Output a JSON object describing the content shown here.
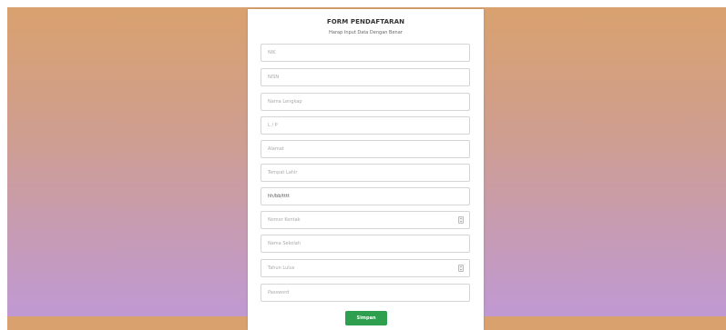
{
  "form": {
    "title": "FORM PENDAFTARAN",
    "subtitle": "Harap Input Data Dengan Benar",
    "fields": [
      {
        "placeholder": "NIK",
        "type": "text"
      },
      {
        "placeholder": "NISN",
        "type": "text"
      },
      {
        "placeholder": "Nama Lengkap",
        "type": "text"
      },
      {
        "placeholder": "L / P",
        "type": "text"
      },
      {
        "placeholder": "Alamat",
        "type": "text"
      },
      {
        "placeholder": "Tempat Lahir",
        "type": "text"
      },
      {
        "value": "hh/bb/tttt",
        "type": "date"
      },
      {
        "placeholder": "Nomor Kontak",
        "type": "number"
      },
      {
        "placeholder": "Nama Sekolah",
        "type": "text"
      },
      {
        "placeholder": "Tahun Lulus",
        "type": "number"
      },
      {
        "placeholder": "Password",
        "type": "password"
      }
    ],
    "submit_label": "Simpan"
  },
  "colors": {
    "background_top": "#d9a16e",
    "background_bottom": "#c099d3",
    "button": "#2e9e4f"
  }
}
